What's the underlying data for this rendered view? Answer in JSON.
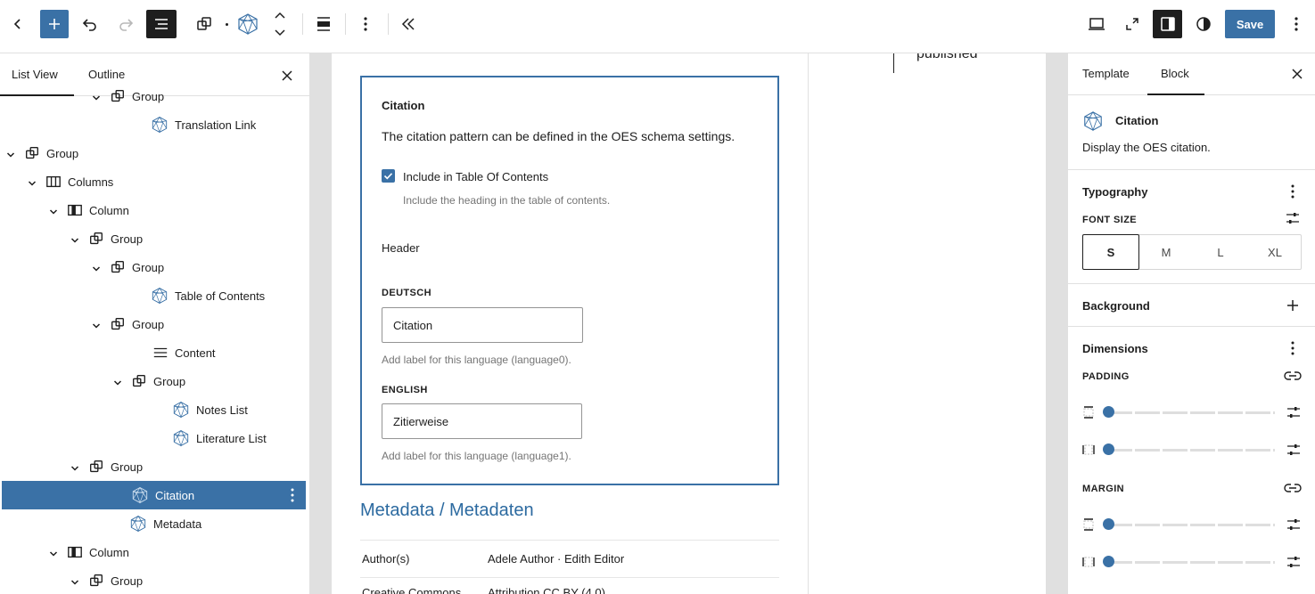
{
  "toolbar": {
    "icons": [
      "back-chevron-icon",
      "add-block-icon",
      "undo-icon",
      "redo-icon",
      "list-view-icon",
      "group-icon",
      "oes-block-icon",
      "move-up-down-icon",
      "align-icon",
      "more-options-icon",
      "collapse-icon"
    ],
    "right_icons": [
      "desktop-preview-icon",
      "fullscreen-icon",
      "sidebar-toggle-icon",
      "contrast-icon",
      "kebab-menu-icon"
    ],
    "save_label": "Save",
    "accent": "#3a71a6"
  },
  "left_panel": {
    "tabs": [
      "List View",
      "Outline"
    ],
    "rows": [
      {
        "label": "Group",
        "type": "group",
        "depth": 4,
        "expanded": true
      },
      {
        "label": "Translation Link",
        "type": "oes",
        "depth": 6
      },
      {
        "label": "Group",
        "type": "group",
        "depth": 0,
        "expanded": true
      },
      {
        "label": "Columns",
        "type": "columns",
        "depth": 1,
        "expanded": true
      },
      {
        "label": "Column",
        "type": "column",
        "depth": 2,
        "expanded": true
      },
      {
        "label": "Group",
        "type": "group",
        "depth": 3,
        "expanded": true
      },
      {
        "label": "Group",
        "type": "group",
        "depth": 4,
        "expanded": true
      },
      {
        "label": "Table of Contents",
        "type": "oes",
        "depth": 6
      },
      {
        "label": "Group",
        "type": "group",
        "depth": 4,
        "expanded": true
      },
      {
        "label": "Content",
        "type": "content",
        "depth": 6
      },
      {
        "label": "Group",
        "type": "group",
        "depth": 5,
        "expanded": true
      },
      {
        "label": "Notes List",
        "type": "oes",
        "depth": 7
      },
      {
        "label": "Literature List",
        "type": "oes",
        "depth": 7
      },
      {
        "label": "Group",
        "type": "group",
        "depth": 3,
        "expanded": true
      },
      {
        "label": "Citation",
        "type": "oes",
        "depth": 5,
        "selected": true
      },
      {
        "label": "Metadata",
        "type": "oes",
        "depth": 5
      },
      {
        "label": "Column",
        "type": "column",
        "depth": 2,
        "expanded": true
      },
      {
        "label": "Group",
        "type": "group",
        "depth": 3,
        "expanded": true
      }
    ]
  },
  "canvas": {
    "published_text": "published",
    "citation_block": {
      "title": "Citation",
      "description": "The citation pattern can be defined in the OES schema settings.",
      "toc_checkbox_label": "Include in Table Of Contents",
      "toc_checkbox_checked": true,
      "toc_help": "Include the heading in the table of contents.",
      "header_label": "Header",
      "languages": [
        {
          "label": "DEUTSCH",
          "value": "Citation",
          "help": "Add label for this language (language0)."
        },
        {
          "label": "ENGLISH",
          "value": "Zitierweise",
          "help": "Add label for this language (language1)."
        }
      ]
    },
    "metadata": {
      "title": "Metadata / Metadaten",
      "rows": [
        {
          "key": "Author(s)",
          "value": "Adele Author · Edith Editor"
        },
        {
          "key": "Creative Commons",
          "value": "Attribution CC BY (4.0)"
        }
      ]
    }
  },
  "right_panel": {
    "tabs": [
      "Template",
      "Block"
    ],
    "active_tab": "Block",
    "block_name": "Citation",
    "block_desc": "Display the OES citation.",
    "typography_title": "Typography",
    "font_size_caption": "FONT SIZE",
    "font_sizes": [
      "S",
      "M",
      "L",
      "XL"
    ],
    "font_size_selected": "S",
    "background_title": "Background",
    "dimensions_title": "Dimensions",
    "padding_caption": "PADDING",
    "margin_caption": "MARGIN",
    "padding_values": [
      0,
      0
    ],
    "margin_values": [
      0,
      0
    ]
  }
}
